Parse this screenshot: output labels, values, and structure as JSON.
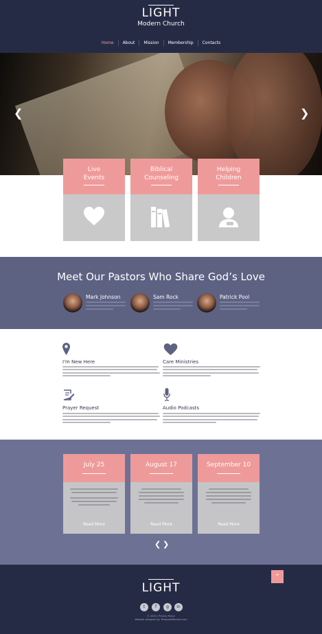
{
  "header": {
    "logo_title": "LIGHT",
    "logo_subtitle": "Modern Church",
    "nav": [
      "Home",
      "About",
      "Mission",
      "Membership",
      "Contacts"
    ],
    "active_nav": "Home"
  },
  "hero": {
    "prev_icon": "chevron-left-icon",
    "next_icon": "chevron-right-icon"
  },
  "features": [
    {
      "line1": "Live",
      "line2": "Events",
      "icon": "heart-icon"
    },
    {
      "line1": "Biblical",
      "line2": "Counseling",
      "icon": "books-icon"
    },
    {
      "line1": "Helping",
      "line2": "Children",
      "icon": "child-icon"
    }
  ],
  "pastors": {
    "title": "Meet Our Pastors Who Share God’s Love",
    "people": [
      "Mark Johnson",
      "Sam Rock",
      "Patrick Pool"
    ]
  },
  "info": [
    {
      "title": "I'm New Here",
      "icon": "map-pin-icon"
    },
    {
      "title": "Care Ministries",
      "icon": "heart-icon"
    },
    {
      "title": "Prayer Request",
      "icon": "edit-note-icon"
    },
    {
      "title": "Audio Podcasts",
      "icon": "microphone-icon"
    }
  ],
  "events": [
    {
      "date": "July 25",
      "more": "Read More"
    },
    {
      "date": "August 17",
      "more": "Read More"
    },
    {
      "date": "September 10",
      "more": "Read More"
    }
  ],
  "footer": {
    "logo": "LIGHT",
    "copyright": "© 2016 | Privacy Policy",
    "credit": "Website designed by TemplateMonster.com",
    "social": [
      "t",
      "f",
      "g",
      "in"
    ]
  },
  "colors": {
    "navy": "#262b45",
    "pink": "#ef9a9a",
    "slate": "#5d6283",
    "grey": "#c9c9c9"
  }
}
